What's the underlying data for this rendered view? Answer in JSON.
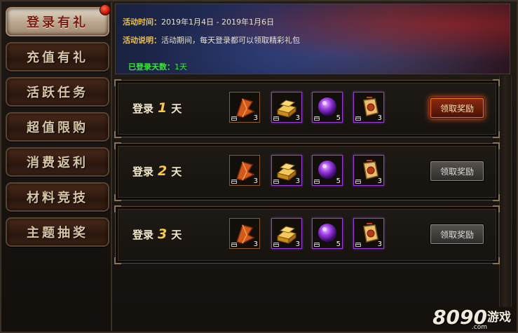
{
  "sidebar": {
    "items": [
      {
        "label": "登录有礼",
        "active": true,
        "badge": true
      },
      {
        "label": "充值有礼"
      },
      {
        "label": "活跃任务"
      },
      {
        "label": "超值限购"
      },
      {
        "label": "消费返利"
      },
      {
        "label": "材料竞技"
      },
      {
        "label": "主题抽奖"
      }
    ]
  },
  "banner": {
    "time_label": "活动时间：",
    "time_value": "2019年1月4日 - 2019年1月6日",
    "desc_label": "活动说明：",
    "desc_value": "活动期间，每天登录都可以领取精彩礼包",
    "days_label": "已登录天数：",
    "days_value": "1天"
  },
  "rows": [
    {
      "day_prefix": "登录",
      "day_num": "1",
      "day_suffix": "天",
      "items": [
        {
          "icon": "orange-leaf-icon",
          "count": "3"
        },
        {
          "icon": "gold-bar-icon",
          "count": "3"
        },
        {
          "icon": "purple-orb-icon",
          "count": "5"
        },
        {
          "icon": "gold-token-icon",
          "count": "3"
        }
      ],
      "claim_label": "领取奖励",
      "claim_state": "available"
    },
    {
      "day_prefix": "登录",
      "day_num": "2",
      "day_suffix": "天",
      "items": [
        {
          "icon": "orange-leaf-icon",
          "count": "3"
        },
        {
          "icon": "gold-bar-icon",
          "count": "3"
        },
        {
          "icon": "purple-orb-icon",
          "count": "5"
        },
        {
          "icon": "gold-token-icon",
          "count": "3"
        }
      ],
      "claim_label": "领取奖励",
      "claim_state": "disabled"
    },
    {
      "day_prefix": "登录",
      "day_num": "3",
      "day_suffix": "天",
      "items": [
        {
          "icon": "orange-leaf-icon",
          "count": "3"
        },
        {
          "icon": "gold-bar-icon",
          "count": "3"
        },
        {
          "icon": "purple-orb-icon",
          "count": "5"
        },
        {
          "icon": "gold-token-icon",
          "count": "3"
        }
      ],
      "claim_label": "领取奖励",
      "claim_state": "disabled"
    }
  ],
  "watermark": {
    "brand": "8090",
    "brand_cn": "游戏",
    "domain": ".com"
  },
  "colors": {
    "accent_gold": "#f0c040",
    "days_green": "#3ce43c",
    "active_glow": "#f07a20"
  }
}
